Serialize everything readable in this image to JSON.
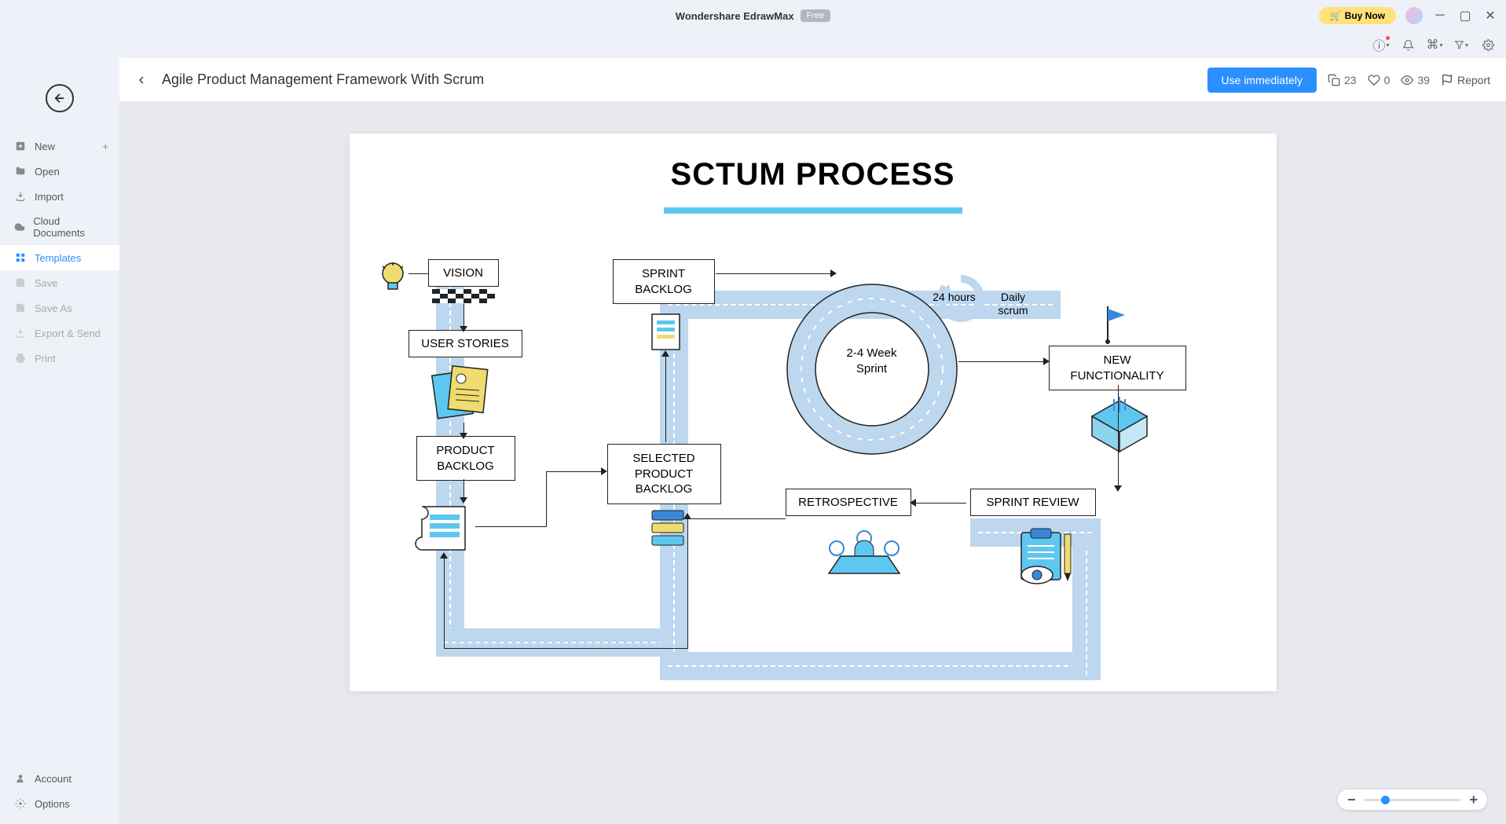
{
  "titlebar": {
    "app_name": "Wondershare EdrawMax",
    "free_label": "Free",
    "buy_label": "Buy Now"
  },
  "sidebar": {
    "items": [
      {
        "label": "New",
        "has_plus": true
      },
      {
        "label": "Open"
      },
      {
        "label": "Import"
      },
      {
        "label": "Cloud Documents"
      },
      {
        "label": "Templates",
        "active": true
      },
      {
        "label": "Save",
        "disabled": true
      },
      {
        "label": "Save As",
        "disabled": true
      },
      {
        "label": "Export & Send",
        "disabled": true
      },
      {
        "label": "Print",
        "disabled": true
      }
    ],
    "footer": {
      "account": "Account",
      "options": "Options"
    }
  },
  "header": {
    "title": "Agile Product Management Framework With Scrum",
    "use_label": "Use immediately",
    "copies": "23",
    "likes": "0",
    "views": "39",
    "report": "Report"
  },
  "diagram": {
    "title": "SCTUM PROCESS",
    "boxes": {
      "vision": "VISION",
      "user_stories": "USER STORIES",
      "product_backlog": "PRODUCT BACKLOG",
      "sprint_backlog": "SPRINT BACKLOG",
      "selected_product_backlog": "SELECTED PRODUCT BACKLOG",
      "retrospective": "RETROSPECTIVE",
      "sprint_review": "SPRINT REVIEW",
      "new_functionality": "NEW FUNCTIONALITY",
      "sprint_duration": "2-4 Week Sprint",
      "hours_label": "24 hours",
      "daily_label": "Daily scrum"
    }
  }
}
